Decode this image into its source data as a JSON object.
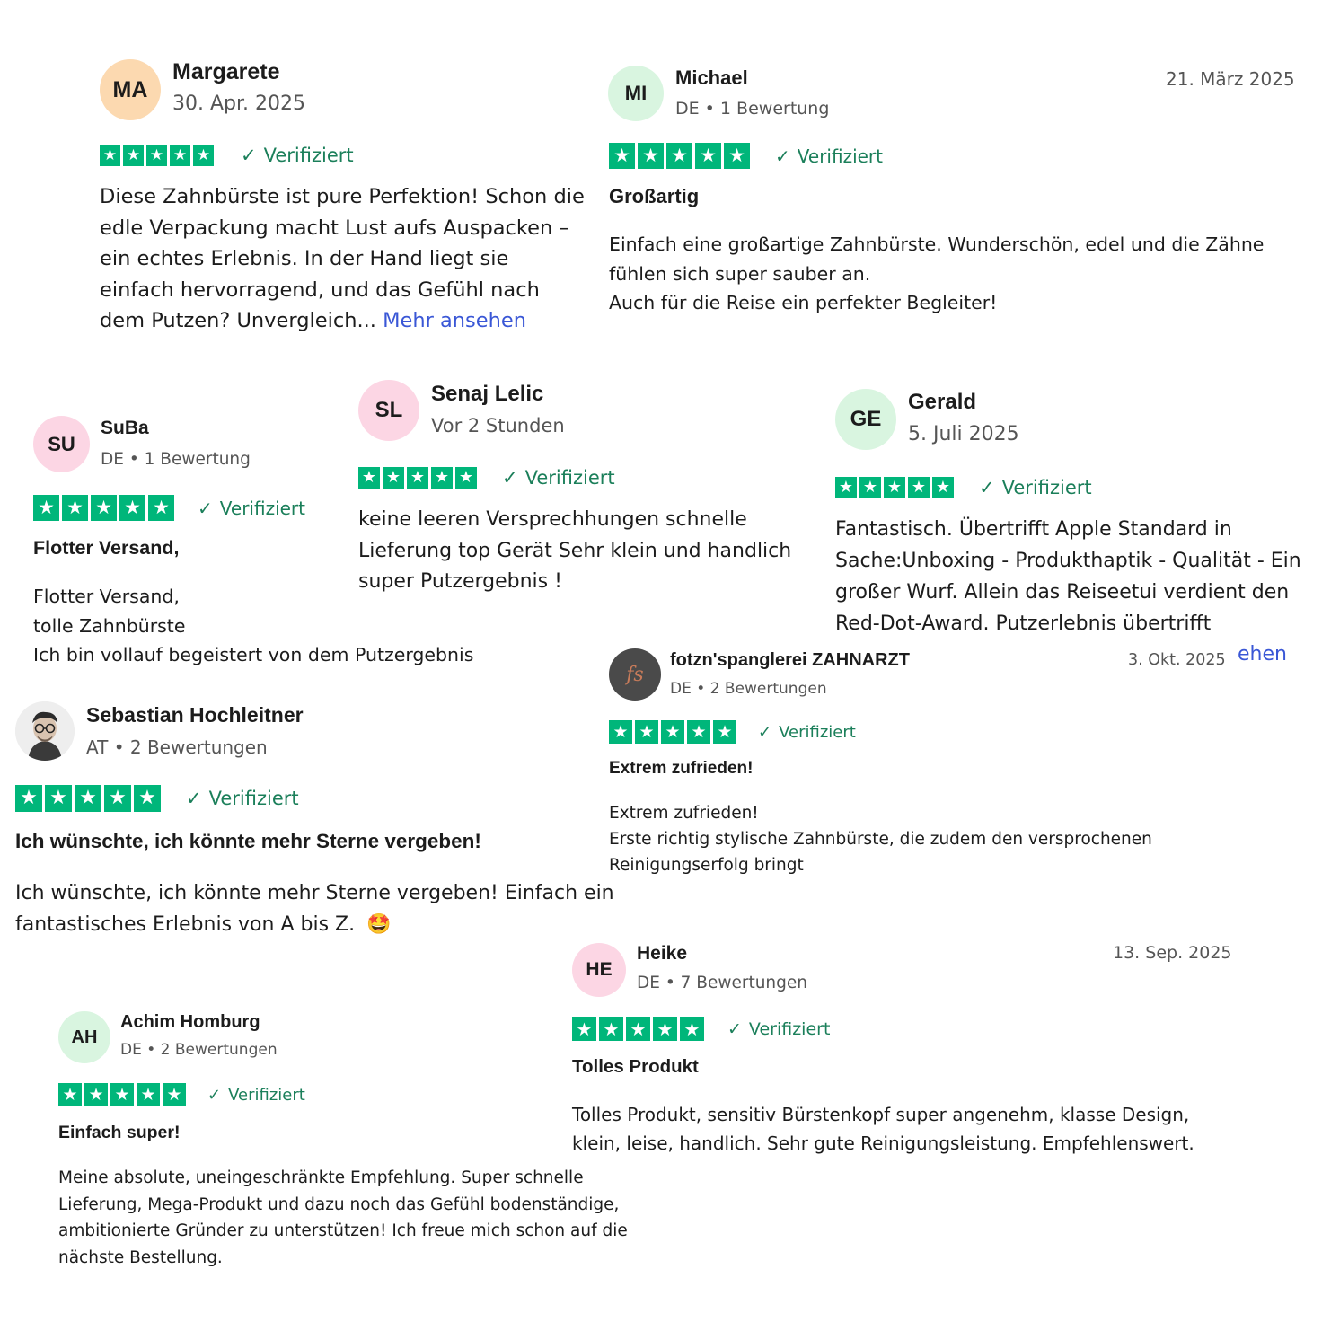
{
  "colors": {
    "star_green": "#00b67a",
    "verified_green": "#1b7f5a",
    "link_blue": "#3a57d6"
  },
  "reviews": {
    "margarete": {
      "initials": "MA",
      "name": "Margarete",
      "date": "30. Apr. 2025",
      "rating": 5,
      "verified": "Verifiziert",
      "body": "Diese Zahnbürste ist pure Perfektion! Schon die edle Verpackung macht Lust aufs Auspacken – ein echtes Erlebnis. In der Hand liegt sie einfach hervorragend, und das Gefühl nach dem Putzen? Unvergleich...",
      "more": "Mehr ansehen"
    },
    "michael": {
      "initials": "MI",
      "name": "Michael",
      "meta": "DE • 1 Bewertung",
      "date": "21. März 2025",
      "rating": 5,
      "verified": "Verifiziert",
      "title": "Großartig",
      "body_lines": [
        "Einfach eine großartige Zahnbürste. Wunderschön, edel und die Zähne",
        "fühlen sich super sauber an.",
        "Auch für die Reise ein perfekter Begleiter!"
      ]
    },
    "suba": {
      "initials": "SU",
      "name": "SuBa",
      "meta": "DE • 1 Bewertung",
      "rating": 5,
      "verified": "Verifiziert",
      "title": "Flotter Versand,",
      "body_lines": [
        "Flotter Versand,",
        "tolle Zahnbürste",
        "Ich bin vollauf begeistert von dem Putzergebnis"
      ]
    },
    "senaj": {
      "initials": "SL",
      "name": "Senaj Lelic",
      "date": "Vor 2 Stunden",
      "rating": 5,
      "verified": "Verifiziert",
      "body": "keine leeren Versprechhungen schnelle Lieferung top Gerät Sehr klein und handlich super Putzergebnis !"
    },
    "gerald": {
      "initials": "GE",
      "name": "Gerald",
      "date": "5. Juli 2025",
      "rating": 5,
      "verified": "Verifiziert",
      "body": "Fantastisch. Übertrifft Apple Standard in Sache:Unboxing - Produkthaptik - Qualität - Ein großer Wurf. Allein das Reiseetui verdient den Red-Dot-Award. Putzerlebnis übertrifft",
      "more_fragment": "ehen"
    },
    "sebastian": {
      "name": "Sebastian Hochleitner",
      "meta": "AT • 2 Bewertungen",
      "rating": 5,
      "verified": "Verifiziert",
      "title": "Ich wünschte, ich könnte mehr Sterne vergeben!",
      "body": "Ich wünschte, ich könnte mehr Sterne vergeben! Einfach ein fantastisches Erlebnis von A bis Z.",
      "emoji": "🤩"
    },
    "fotzn": {
      "name": "fotzn'spanglerei ZAHNARZT",
      "meta": "DE • 2 Bewertungen",
      "date": "3. Okt. 2025",
      "rating": 5,
      "verified": "Verifiziert",
      "title": "Extrem zufrieden!",
      "body_lines": [
        "Extrem zufrieden!",
        "Erste richtig stylische Zahnbürste, die zudem den versprochenen",
        "Reinigungserfolg bringt"
      ],
      "logo_text": "fs"
    },
    "heike": {
      "initials": "HE",
      "name": "Heike",
      "meta": "DE • 7 Bewertungen",
      "date": "13. Sep. 2025",
      "rating": 5,
      "verified": "Verifiziert",
      "title": "Tolles Produkt",
      "body_lines": [
        "Tolles Produkt, sensitiv Bürstenkopf super angenehm, klasse Design,",
        "klein, leise, handlich. Sehr gute Reinigungsleistung. Empfehlenswert."
      ]
    },
    "achim": {
      "initials": "AH",
      "name": "Achim Homburg",
      "meta": "DE • 2 Bewertungen",
      "rating": 5,
      "verified": "Verifiziert",
      "title": "Einfach super!",
      "body_lines": [
        "Meine absolute, uneingeschränkte Empfehlung. Super schnelle",
        "Lieferung, Mega-Produkt und dazu noch das Gefühl bodenständige,",
        "ambitionierte Gründer zu unterstützen! Ich freue mich schon auf die",
        "nächste Bestellung."
      ]
    }
  }
}
